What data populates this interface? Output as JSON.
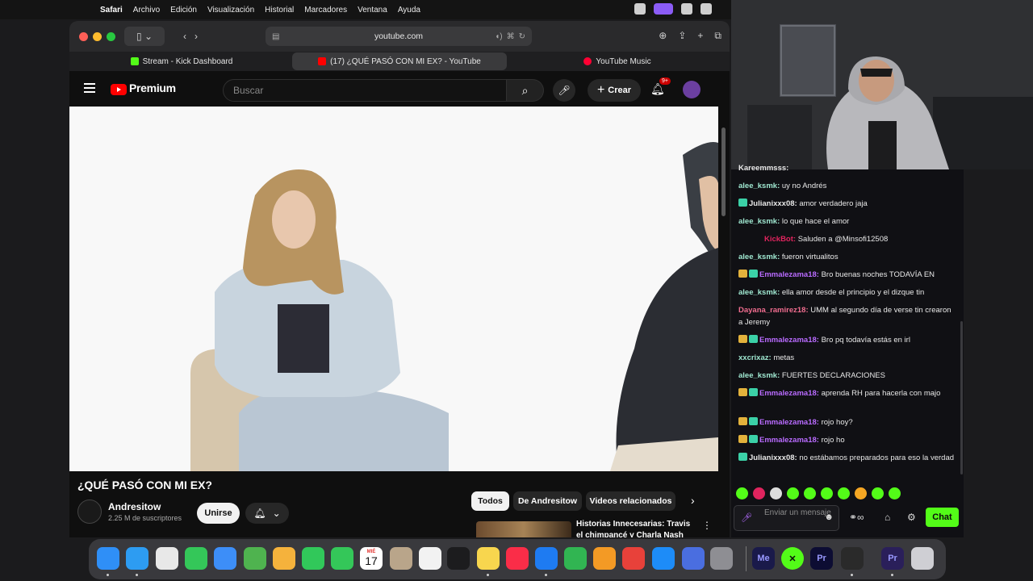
{
  "menubar": {
    "items": [
      "Safari",
      "Archivo",
      "Edición",
      "Visualización",
      "Historial",
      "Marcadores",
      "Ventana",
      "Ayuda"
    ]
  },
  "safari": {
    "url": "youtube.com",
    "tabs": [
      {
        "label": "Stream - Kick Dashboard"
      },
      {
        "label": "(17) ¿QUÉ PASÓ CON MI EX? - YouTube"
      },
      {
        "label": "YouTube Music"
      }
    ]
  },
  "youtube": {
    "brand": "Premium",
    "search_placeholder": "Buscar",
    "create_label": "Crear",
    "notif_count": "9+",
    "video_title": "¿QUÉ PASÓ CON MI EX?",
    "channel_name": "Andresitow",
    "subscribers": "2.25 M de suscriptores",
    "join_label": "Unirse",
    "chips": [
      "Todos",
      "De Andresitow",
      "Videos relacionados"
    ],
    "related_title": "Historias Innecesarias: Travis el chimpancé y Charla Nash"
  },
  "chat": {
    "messages": [
      {
        "user": "Kareemmsss:",
        "text": "",
        "color": "#e8e8e8",
        "badges": []
      },
      {
        "user": "alee_ksmk:",
        "text": "uy no Andrés",
        "color": "#9fe7d0",
        "badges": []
      },
      {
        "user": "Julianixxx08:",
        "text": "amor verdadero jaja",
        "color": "#e8e8e8",
        "badges": [
          "sub"
        ]
      },
      {
        "user": "alee_ksmk:",
        "text": "lo que hace el amor",
        "color": "#9fe7d0",
        "badges": []
      },
      {
        "user": "KickBot:",
        "text": "Saluden a @Minsofi12508",
        "color": "#e0245e",
        "badges": []
      },
      {
        "user": "alee_ksmk:",
        "text": "fueron virtualitos",
        "color": "#9fe7d0",
        "badges": []
      },
      {
        "user": "Emmalezama18:",
        "text": "Bro buenas noches TODAVÍA EN",
        "color": "#b96bff",
        "badges": [
          "crown",
          "sub"
        ]
      },
      {
        "user": "alee_ksmk:",
        "text": "ella amor desde el principio y el dizque tin",
        "color": "#9fe7d0",
        "badges": []
      },
      {
        "user": "Dayana_ramirez18:",
        "text": "UMM al segundo día de verse tin crearon a Jeremy",
        "color": "#f06d8f",
        "badges": []
      },
      {
        "user": "Emmalezama18:",
        "text": "Bro pq todavía estás en irl",
        "color": "#b96bff",
        "badges": [
          "crown",
          "sub"
        ]
      },
      {
        "user": "xxcrixaz:",
        "text": "metas",
        "color": "#9fe7d0",
        "badges": []
      },
      {
        "user": "alee_ksmk:",
        "text": "FUERTES DECLARACIONES",
        "color": "#9fe7d0",
        "badges": []
      },
      {
        "user": "Emmalezama18:",
        "text": "aprenda RH para hacerla con majo",
        "color": "#b96bff",
        "badges": [
          "crown",
          "sub"
        ]
      },
      {
        "user": "Emmalezama18:",
        "text": "rojo hoy?",
        "color": "#b96bff",
        "badges": [
          "crown",
          "sub"
        ]
      },
      {
        "user": "Emmalezama18:",
        "text": "rojo ho",
        "color": "#b96bff",
        "badges": [
          "crown",
          "sub"
        ]
      },
      {
        "user": "Julianixxx08:",
        "text": "no estábamos preparados para eso la verdad",
        "color": "#e8e8e8",
        "badges": [
          "sub"
        ]
      }
    ],
    "input_placeholder": "Enviar un mensaje",
    "chat_button": "Chat"
  },
  "dock": {
    "apps": [
      "Finder",
      "Safari",
      "Launchpad",
      "Messages",
      "Mail",
      "Maps",
      "Photos",
      "FaceTime",
      "Phone",
      "Calendar",
      "Contacts",
      "Reminders",
      "Apple TV",
      "Notes",
      "Music",
      "Keynote",
      "Numbers",
      "Pages",
      "Rocket Typist",
      "App Store",
      "Simulator",
      "System Settings",
      "Media Encoder",
      "Kick",
      "Premiere Pro",
      "OBS",
      "Premiere Pro Beta",
      "Trash"
    ],
    "calendar_day": "17",
    "calendar_month": "MIÉ"
  }
}
